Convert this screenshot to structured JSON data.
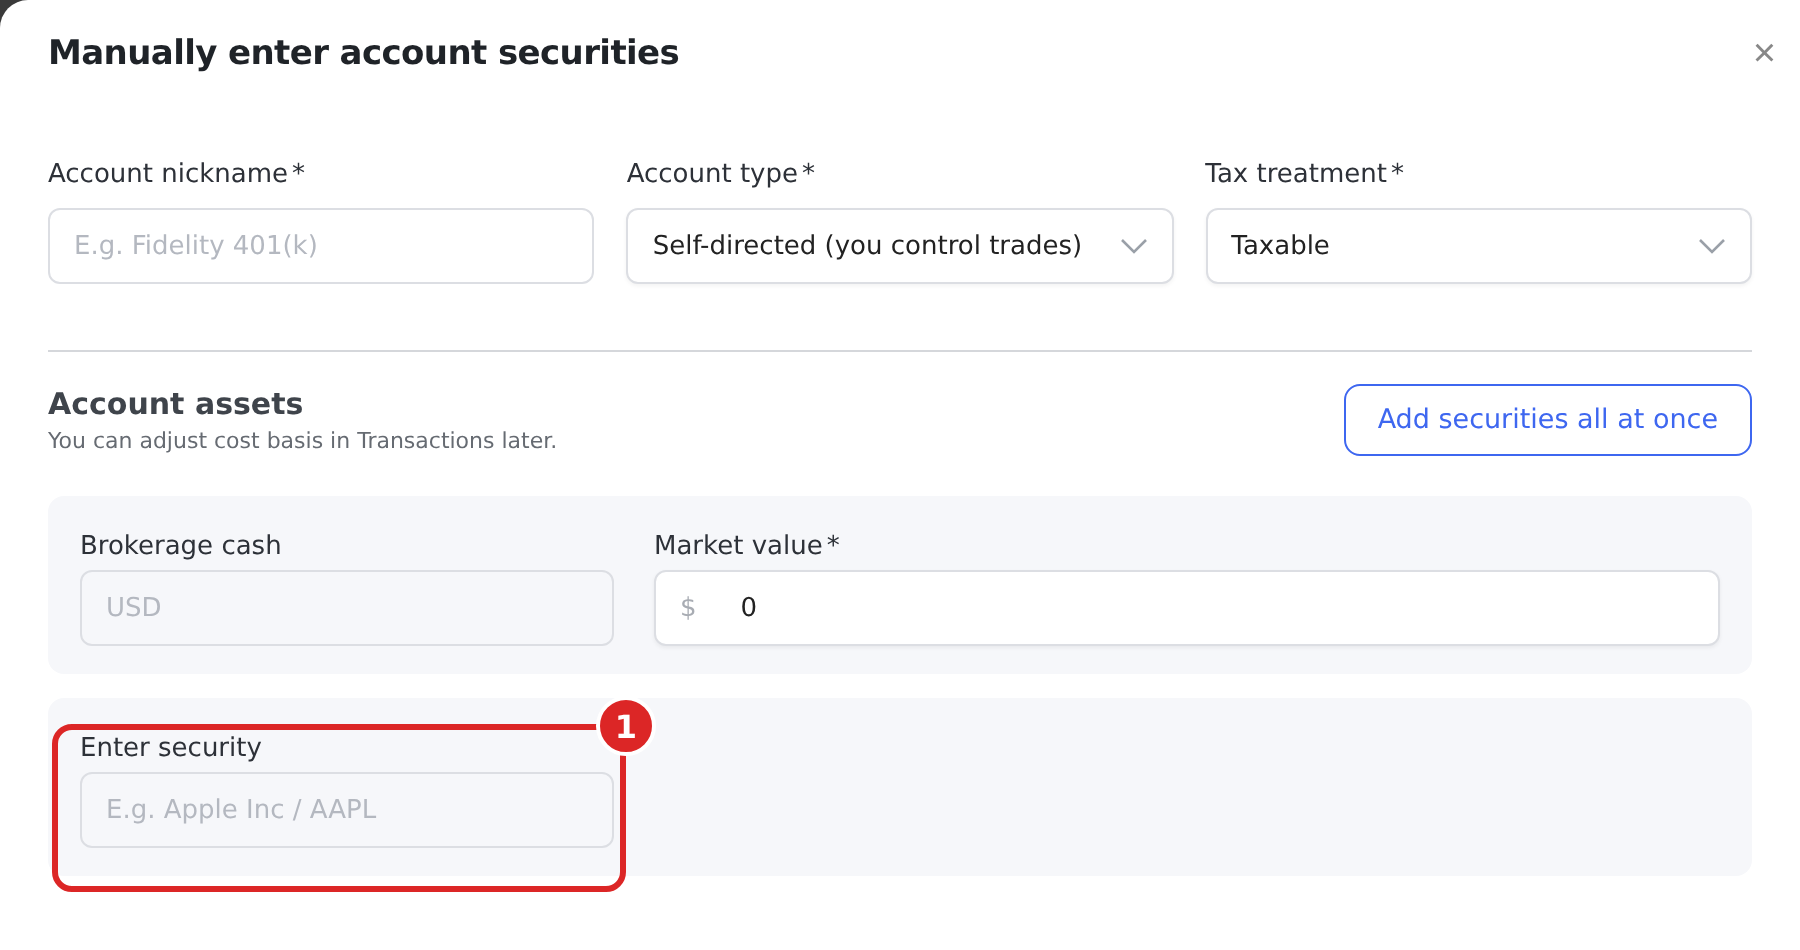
{
  "dialog": {
    "title": "Manually enter account securities",
    "close": "×"
  },
  "fields": [
    {
      "kind": "text",
      "label": "Account nickname",
      "required_mark": "*",
      "placeholder": "E.g. Fidelity 401(k)"
    },
    {
      "kind": "select",
      "label": "Account type",
      "required_mark": "*",
      "value": "Self-directed (you control trades)"
    },
    {
      "kind": "select",
      "label": "Tax treatment",
      "required_mark": "*",
      "value": "Taxable"
    }
  ],
  "assets": {
    "title": "Account assets",
    "subtitle": "You can adjust cost basis in Transactions later.",
    "button": "Add securities all at once",
    "cash": {
      "label": "Brokerage cash",
      "placeholder": "USD"
    },
    "market": {
      "label": "Market value",
      "required_mark": "*",
      "prefix": "$",
      "value": "0"
    },
    "security": {
      "label": "Enter security",
      "placeholder": "E.g. Apple Inc / AAPL"
    }
  },
  "annotation": {
    "number": "1"
  }
}
